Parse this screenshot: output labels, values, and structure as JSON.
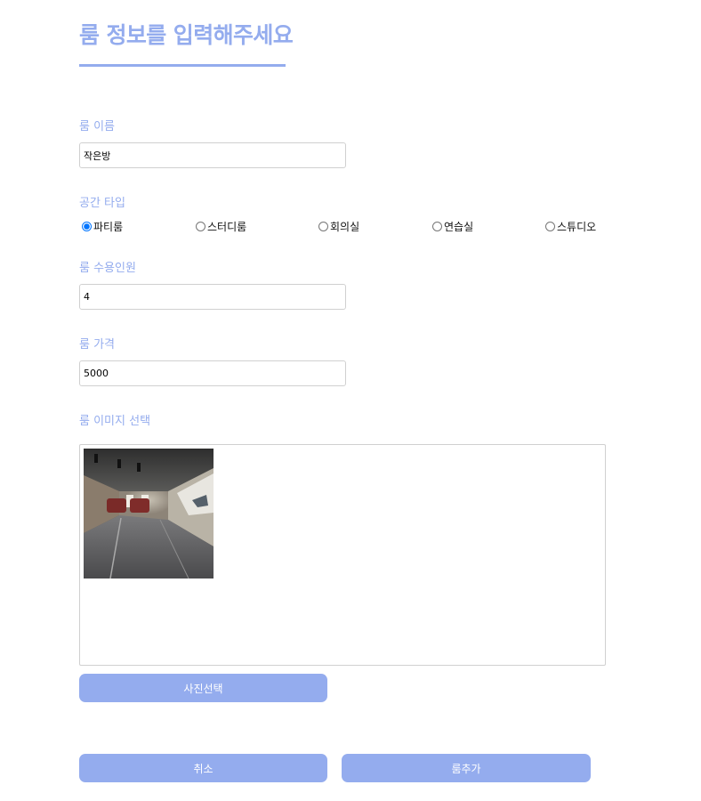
{
  "title": "룸 정보를 입력해주세요",
  "fields": {
    "room_name": {
      "label": "룸 이름",
      "value": "작은방"
    },
    "space_type": {
      "label": "공간 타입",
      "options": [
        "파티룸",
        "스터디룸",
        "회의실",
        "연습실",
        "스튜디오"
      ],
      "selected": "파티룸"
    },
    "capacity": {
      "label": "룸 수용인원",
      "value": "4"
    },
    "price": {
      "label": "룸 가격",
      "value": "5000"
    },
    "image": {
      "label": "룸 이미지 선택"
    }
  },
  "buttons": {
    "select_photo": "사진선택",
    "cancel": "취소",
    "add_room": "룸추가"
  },
  "colors": {
    "accent": "#94acee",
    "border": "#d0d0d0"
  }
}
